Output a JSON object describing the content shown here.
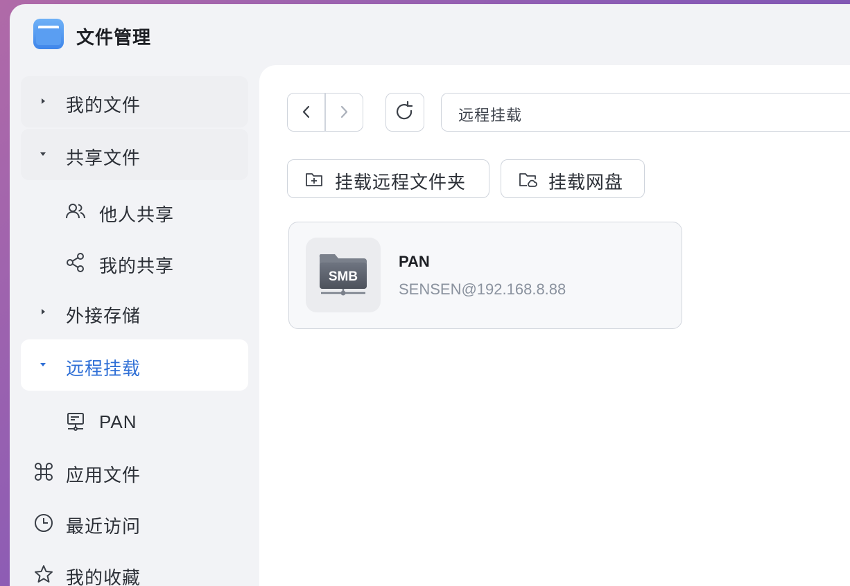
{
  "app": {
    "title": "文件管理"
  },
  "sidebar": {
    "items": [
      {
        "label": "我的文件"
      },
      {
        "label": "共享文件"
      },
      {
        "label": "他人共享"
      },
      {
        "label": "我的共享"
      },
      {
        "label": "外接存储"
      },
      {
        "label": "远程挂载"
      },
      {
        "label": "PAN"
      },
      {
        "label": "应用文件"
      },
      {
        "label": "最近访问"
      },
      {
        "label": "我的收藏"
      }
    ]
  },
  "toolbar": {
    "path": "远程挂载",
    "mount_remote_folder": "挂载远程文件夹",
    "mount_cloud_drive": "挂载网盘"
  },
  "content": {
    "mounts": [
      {
        "name": "PAN",
        "address": "SENSEN@192.168.8.88",
        "badge": "SMB"
      }
    ]
  },
  "colors": {
    "accent": "#2f6fd6",
    "sidebar_bg": "#f2f3f6",
    "active_item_bg": "#ffffff"
  }
}
